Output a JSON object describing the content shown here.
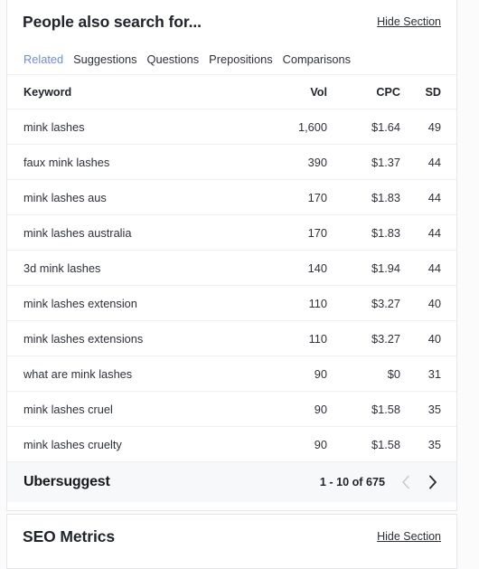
{
  "sections": {
    "people_also_search": {
      "title": "People also search for...",
      "hide_label": "Hide Section",
      "tabs": [
        {
          "label": "Related",
          "active": true
        },
        {
          "label": "Suggestions",
          "active": false
        },
        {
          "label": "Questions",
          "active": false
        },
        {
          "label": "Prepositions",
          "active": false
        },
        {
          "label": "Comparisons",
          "active": false
        }
      ],
      "table": {
        "columns": [
          "Keyword",
          "Vol",
          "CPC",
          "SD"
        ],
        "rows": [
          {
            "keyword": "mink lashes",
            "vol": "1,600",
            "cpc": "$1.64",
            "sd": "49"
          },
          {
            "keyword": "faux mink lashes",
            "vol": "390",
            "cpc": "$1.37",
            "sd": "44"
          },
          {
            "keyword": "mink lashes aus",
            "vol": "170",
            "cpc": "$1.83",
            "sd": "44"
          },
          {
            "keyword": "mink lashes australia",
            "vol": "170",
            "cpc": "$1.83",
            "sd": "44"
          },
          {
            "keyword": "3d mink lashes",
            "vol": "140",
            "cpc": "$1.94",
            "sd": "44"
          },
          {
            "keyword": "mink lashes extension",
            "vol": "110",
            "cpc": "$3.27",
            "sd": "40"
          },
          {
            "keyword": "mink lashes extensions",
            "vol": "110",
            "cpc": "$3.27",
            "sd": "40"
          },
          {
            "keyword": "what are mink lashes",
            "vol": "90",
            "cpc": "$0",
            "sd": "31"
          },
          {
            "keyword": "mink lashes cruel",
            "vol": "90",
            "cpc": "$1.58",
            "sd": "35"
          },
          {
            "keyword": "mink lashes cruelty",
            "vol": "90",
            "cpc": "$1.58",
            "sd": "35"
          }
        ]
      },
      "footer": {
        "brand": "Ubersuggest",
        "pagination_label": "1 - 10 of 675",
        "prev_icon": "chevron-left-icon",
        "next_icon": "chevron-right-icon",
        "prev_enabled": false,
        "next_enabled": true
      }
    },
    "seo_metrics": {
      "title": "SEO Metrics",
      "hide_label": "Hide Section"
    }
  },
  "colors": {
    "accent_tab_active": "#6d8ce0",
    "text_primary": "#20242b",
    "text_body": "#2d3139",
    "border": "#eceef0",
    "card_border": "#e7e7e9",
    "footer_bg": "#f7f8f9",
    "page_bg": "#fbfbfb",
    "chevron_disabled": "#c9cbcf",
    "chevron_enabled": "#2b2f36"
  }
}
